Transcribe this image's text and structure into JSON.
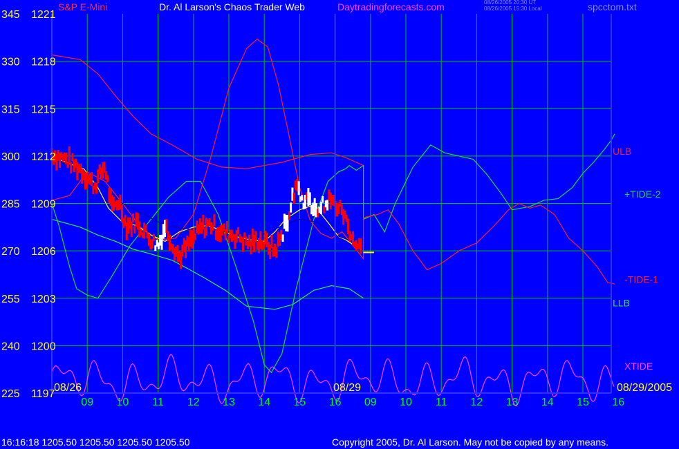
{
  "header": {
    "instrument": "S&P E-Mini",
    "title": "Dr. Al Larson's Chaos Trader Web",
    "site": "Daytradingforecasts.com",
    "stamp_ut": "08/26/2005 20:30 UT",
    "stamp_local": "08/26/2005 15:30 Local",
    "filename": "spcctom.txt"
  },
  "footer": {
    "readout": "16:16:18   1205.50  1205.50  1205.50  1205.50",
    "copyright": "Copyright 2005, Dr. Al Larson. May not be copied by any means."
  },
  "colors": {
    "background": "#0000ff",
    "grid": "#00c000",
    "axis_left": "#ffff00",
    "axis_bottom": "#00ff00",
    "price_bar": "#ff0000",
    "price_bar_up": "#ffffff",
    "ulb": "#ff2020",
    "llb": "#33ee33",
    "tide_plus2": "#22dd22",
    "tide_minus1": "#ff2020",
    "xtide": "#ff44ff",
    "ma_yellow": "#ffff00",
    "ma_blue": "#0000aa"
  },
  "chart_data": {
    "type": "line",
    "title": "S&P E-Mini",
    "y_tides_ticks": [
      345,
      330,
      315,
      300,
      285,
      270,
      255,
      240,
      225
    ],
    "y_price_ticks": [
      "1221",
      "1218",
      "1215",
      "1212",
      "1209",
      "1206",
      "1203",
      "1200",
      "1197"
    ],
    "y_price_range": [
      1197,
      1221
    ],
    "x_hour_ticks": [
      "09",
      "10",
      "11",
      "12",
      "13",
      "14",
      "15",
      "16",
      "09",
      "10",
      "11",
      "12",
      "13",
      "14",
      "15",
      "16"
    ],
    "date_labels": [
      "08/26",
      "08/29",
      "08/29/2005"
    ],
    "divider_hour": 16,
    "right_labels": [
      {
        "text": "ULB",
        "series": "ulb"
      },
      {
        "text": "+TIDE-2",
        "series": "tide_plus2"
      },
      {
        "text": "-TIDE-1",
        "series": "tide_minus1"
      },
      {
        "text": "LLB",
        "series": "llb"
      },
      {
        "text": "XTIDE",
        "series": "xtide"
      }
    ],
    "series": [
      {
        "key": "ulb",
        "color_key": "ulb",
        "points": [
          [
            0,
            1218.4
          ],
          [
            0.8,
            1218.1
          ],
          [
            1.3,
            1217.2
          ],
          [
            1.8,
            1215.8
          ],
          [
            2.3,
            1214.5
          ],
          [
            2.8,
            1213.4
          ],
          [
            3.4,
            1212.7
          ],
          [
            4.1,
            1211.8
          ],
          [
            4.8,
            1211.3
          ],
          [
            5.5,
            1211.2
          ],
          [
            6.5,
            1211.6
          ],
          [
            7.3,
            1212.1
          ],
          [
            7.9,
            1212.2
          ],
          [
            8.3,
            1211.9
          ],
          [
            8.8,
            1211.4
          ]
        ]
      },
      {
        "key": "llb",
        "color_key": "llb",
        "points": [
          [
            0,
            1208.0
          ],
          [
            0.8,
            1207.5
          ],
          [
            1.3,
            1207.0
          ],
          [
            1.8,
            1206.6
          ],
          [
            2.3,
            1206.1
          ],
          [
            2.8,
            1205.8
          ],
          [
            3.4,
            1205.4
          ],
          [
            3.9,
            1204.8
          ],
          [
            4.3,
            1204.3
          ],
          [
            4.9,
            1203.5
          ],
          [
            5.5,
            1202.5
          ],
          [
            6.3,
            1202.3
          ],
          [
            6.8,
            1202.6
          ],
          [
            7.4,
            1203.5
          ],
          [
            7.9,
            1203.8
          ],
          [
            8.4,
            1203.6
          ],
          [
            8.8,
            1203.0
          ]
        ]
      },
      {
        "key": "tide_plus2",
        "color_key": "tide_plus2",
        "points": [
          [
            0,
            1209.0
          ],
          [
            0.2,
            1207.6
          ],
          [
            0.5,
            1205.0
          ],
          [
            0.7,
            1203.6
          ],
          [
            1.0,
            1203.2
          ],
          [
            1.3,
            1203.0
          ],
          [
            1.7,
            1204.4
          ],
          [
            2.2,
            1206.3
          ],
          [
            2.8,
            1208.0
          ],
          [
            3.3,
            1209.4
          ],
          [
            3.8,
            1210.4
          ],
          [
            4.2,
            1210.4
          ],
          [
            4.7,
            1208.3
          ],
          [
            5.2,
            1205.0
          ],
          [
            5.7,
            1201.5
          ],
          [
            6.0,
            1198.8
          ],
          [
            6.2,
            1198.3
          ],
          [
            6.5,
            1199.5
          ],
          [
            6.9,
            1203.6
          ],
          [
            7.4,
            1208.0
          ],
          [
            7.8,
            1210.4
          ],
          [
            8.1,
            1211.0
          ],
          [
            8.3,
            1211.2
          ],
          [
            8.4,
            1211.4
          ],
          [
            8.6,
            1211.1
          ],
          [
            8.8,
            1211.4
          ],
          [
            8.8,
            1208.0
          ],
          [
            9.1,
            1208.3
          ],
          [
            9.4,
            1207.2
          ],
          [
            9.7,
            1209.0
          ],
          [
            10.2,
            1211.3
          ],
          [
            10.7,
            1212.7
          ],
          [
            11.1,
            1212.2
          ],
          [
            11.5,
            1212.0
          ],
          [
            11.9,
            1211.8
          ],
          [
            12.3,
            1210.8
          ],
          [
            12.7,
            1209.6
          ],
          [
            13.0,
            1208.6
          ],
          [
            13.5,
            1208.8
          ],
          [
            13.9,
            1209.2
          ],
          [
            14.3,
            1209.3
          ],
          [
            14.7,
            1210.0
          ],
          [
            15.0,
            1210.9
          ],
          [
            15.3,
            1211.6
          ],
          [
            15.6,
            1212.4
          ],
          [
            15.8,
            1213.0
          ],
          [
            15.9,
            1213.4
          ]
        ]
      },
      {
        "key": "tide_minus1",
        "color_key": "tide_minus1",
        "points": [
          [
            0,
            1209.2
          ],
          [
            0.5,
            1209.5
          ],
          [
            1.0,
            1211.0
          ],
          [
            1.5,
            1210.4
          ],
          [
            2.0,
            1209.0
          ],
          [
            2.5,
            1207.5
          ],
          [
            3.0,
            1206.7
          ],
          [
            3.5,
            1206.8
          ],
          [
            4.0,
            1208.3
          ],
          [
            4.5,
            1212.0
          ],
          [
            5.0,
            1216.3
          ],
          [
            5.5,
            1218.8
          ],
          [
            5.8,
            1219.4
          ],
          [
            6.1,
            1218.9
          ],
          [
            6.4,
            1216.5
          ],
          [
            6.7,
            1213.3
          ],
          [
            7.0,
            1210.0
          ],
          [
            7.3,
            1207.9
          ],
          [
            7.6,
            1207.1
          ],
          [
            7.9,
            1206.8
          ],
          [
            8.2,
            1207.2
          ],
          [
            8.8,
            1205.5
          ],
          [
            8.8,
            1208.1
          ],
          [
            9.2,
            1208.3
          ],
          [
            9.5,
            1208.6
          ],
          [
            9.8,
            1207.7
          ],
          [
            10.2,
            1206.0
          ],
          [
            10.6,
            1204.8
          ],
          [
            11.0,
            1205.2
          ],
          [
            11.5,
            1206.0
          ],
          [
            12.0,
            1206.5
          ],
          [
            12.5,
            1207.6
          ],
          [
            12.9,
            1208.6
          ],
          [
            13.2,
            1209.0
          ],
          [
            13.5,
            1208.7
          ],
          [
            13.8,
            1208.9
          ],
          [
            14.2,
            1208.3
          ],
          [
            14.6,
            1206.8
          ],
          [
            15.0,
            1206.0
          ],
          [
            15.4,
            1205.0
          ],
          [
            15.7,
            1204.0
          ],
          [
            15.9,
            1203.9
          ]
        ]
      },
      {
        "key": "ma_yellow",
        "color_key": "ma_yellow",
        "points": [
          [
            0.0,
            1212.0
          ],
          [
            0.5,
            1211.5
          ],
          [
            0.9,
            1211.2
          ],
          [
            1.3,
            1210.0
          ],
          [
            1.6,
            1208.7
          ],
          [
            2.0,
            1207.8
          ],
          [
            2.4,
            1207.6
          ],
          [
            2.8,
            1207.0
          ],
          [
            3.2,
            1206.6
          ],
          [
            3.6,
            1207.2
          ],
          [
            4.0,
            1207.5
          ],
          [
            4.4,
            1207.6
          ],
          [
            4.8,
            1207.3
          ],
          [
            5.2,
            1206.9
          ],
          [
            5.6,
            1206.7
          ],
          [
            6.0,
            1206.6
          ],
          [
            6.3,
            1207.2
          ],
          [
            6.6,
            1208.0
          ],
          [
            7.0,
            1208.6
          ],
          [
            7.4,
            1208.9
          ],
          [
            7.8,
            1207.8
          ],
          [
            8.1,
            1206.9
          ],
          [
            8.3,
            1206.7
          ],
          [
            8.7,
            1206.1
          ]
        ]
      },
      {
        "key": "ma_blue",
        "color_key": "ma_blue",
        "points": [
          [
            0.0,
            1211.8
          ],
          [
            0.8,
            1211.2
          ],
          [
            1.5,
            1210.0
          ],
          [
            2.0,
            1209.0
          ],
          [
            2.6,
            1208.3
          ],
          [
            3.2,
            1207.6
          ],
          [
            3.8,
            1207.4
          ],
          [
            4.4,
            1207.3
          ],
          [
            5.0,
            1207.2
          ],
          [
            5.6,
            1207.0
          ],
          [
            6.1,
            1207.1
          ],
          [
            6.5,
            1207.6
          ],
          [
            7.0,
            1208.0
          ],
          [
            7.5,
            1207.8
          ],
          [
            8.0,
            1207.0
          ],
          [
            8.5,
            1206.6
          ]
        ]
      }
    ],
    "xtide": {
      "color_key": "xtide",
      "baseline": 1197.8,
      "amplitude": 1.5,
      "x_range": [
        0,
        15.9
      ],
      "note_peaks": [
        [
          1.4,
          1199.7
        ],
        [
          7.4,
          1200.2
        ],
        [
          8.2,
          1199.8
        ],
        [
          15.6,
          1199.5
        ]
      ]
    },
    "price_path": [
      [
        0,
        1212.1
      ],
      [
        0.4,
        1211.8
      ],
      [
        0.8,
        1211.2
      ],
      [
        1.2,
        1210.1
      ],
      [
        1.5,
        1211.4
      ],
      [
        1.7,
        1208.6
      ],
      [
        1.9,
        1209.2
      ],
      [
        2.1,
        1207.6
      ],
      [
        2.4,
        1207.8
      ],
      [
        2.7,
        1207.0
      ],
      [
        3.0,
        1206.3
      ],
      [
        3.2,
        1207.6
      ],
      [
        3.4,
        1206.5
      ],
      [
        3.6,
        1205.6
      ],
      [
        3.9,
        1206.5
      ],
      [
        4.2,
        1207.4
      ],
      [
        4.5,
        1207.7
      ],
      [
        4.7,
        1207.3
      ],
      [
        5.0,
        1207.1
      ],
      [
        5.3,
        1206.9
      ],
      [
        5.6,
        1206.4
      ],
      [
        5.8,
        1206.7
      ],
      [
        6.1,
        1206.4
      ],
      [
        6.3,
        1206.0
      ],
      [
        6.5,
        1207.0
      ],
      [
        6.7,
        1208.4
      ],
      [
        6.9,
        1210.3
      ],
      [
        7.1,
        1209.2
      ],
      [
        7.4,
        1209.0
      ],
      [
        7.6,
        1208.7
      ],
      [
        7.8,
        1209.3
      ],
      [
        8.0,
        1208.9
      ],
      [
        8.2,
        1208.6
      ],
      [
        8.4,
        1207.4
      ],
      [
        8.6,
        1206.3
      ],
      [
        8.75,
        1206.1
      ]
    ],
    "last_mark": {
      "x": 8.9,
      "y": 1205.9
    }
  }
}
